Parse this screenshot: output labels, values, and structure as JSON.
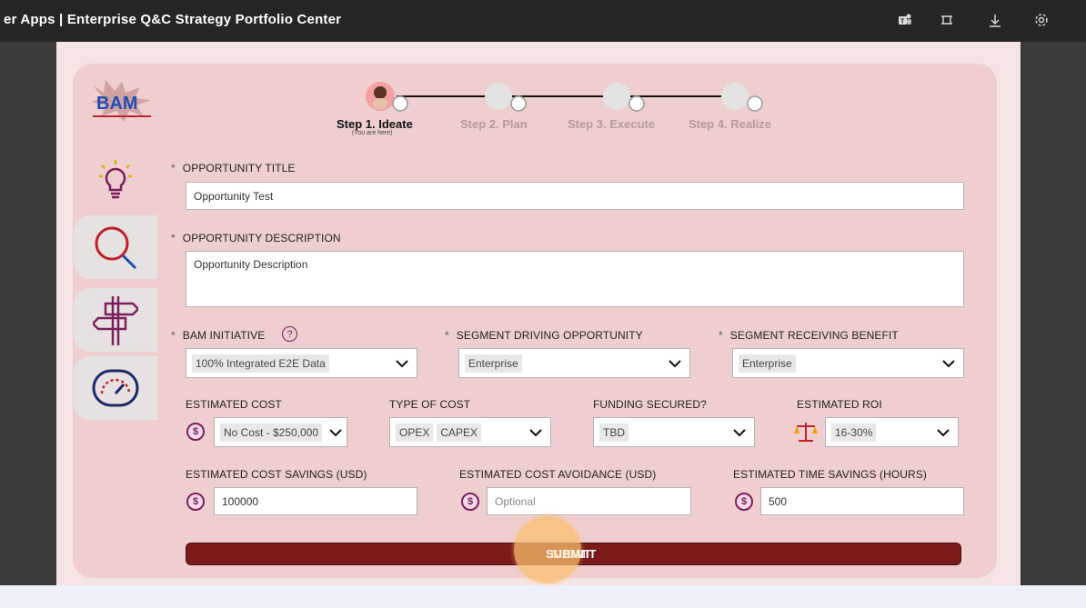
{
  "window": {
    "title": "er Apps  |  Enterprise Q&C Strategy Portfolio Center",
    "icons": [
      "teams-icon",
      "fit-screen-icon",
      "download-icon",
      "settings-icon"
    ]
  },
  "logo": {
    "text": "BAM"
  },
  "stepper": {
    "steps": [
      {
        "label": "Step 1. Ideate",
        "sub": "(You are here)",
        "active": true
      },
      {
        "label": "Step 2. Plan"
      },
      {
        "label": "Step 3. Execute"
      },
      {
        "label": "Step 4. Realize"
      }
    ]
  },
  "sidebar": {
    "items": [
      "lightbulb-icon",
      "magnifier-icon",
      "signpost-icon",
      "speedometer-icon"
    ]
  },
  "form": {
    "title_label": "OPPORTUNITY TITLE",
    "title_value": "Opportunity Test",
    "description_label": "OPPORTUNITY DESCRIPTION",
    "description_value": "Opportunity Description",
    "initiative_label": "BAM INITIATIVE",
    "initiative_help": "?",
    "initiative_value": "100% Integrated E2E Data",
    "segment_driving_label": "SEGMENT DRIVING OPPORTUNITY",
    "segment_driving_value": "Enterprise",
    "segment_receiving_label": "SEGMENT RECEIVING BENEFIT",
    "segment_receiving_value": "Enterprise",
    "cost_label": "ESTIMATED COST",
    "cost_value": "No Cost - $250,000",
    "type_cost_label": "TYPE OF COST",
    "type_cost_values": [
      "OPEX",
      "CAPEX"
    ],
    "funding_label": "FUNDING SECURED?",
    "funding_value": "TBD",
    "roi_label": "ESTIMATED ROI",
    "roi_value": "16-30%",
    "savings_label": "ESTIMATED COST SAVINGS (USD)",
    "savings_value": "100000",
    "avoidance_label": "ESTIMATED COST AVOIDANCE (USD)",
    "avoidance_placeholder": "Optional",
    "time_label": "ESTIMATED TIME SAVINGS (HOURS)",
    "time_value": "500",
    "required_mark": "*",
    "currency_symbol": "$",
    "submit_label": "SUBMIT"
  },
  "colors": {
    "accent": "#7a1f5c",
    "panel": "#efcecf",
    "submit": "#7a1a1a"
  }
}
